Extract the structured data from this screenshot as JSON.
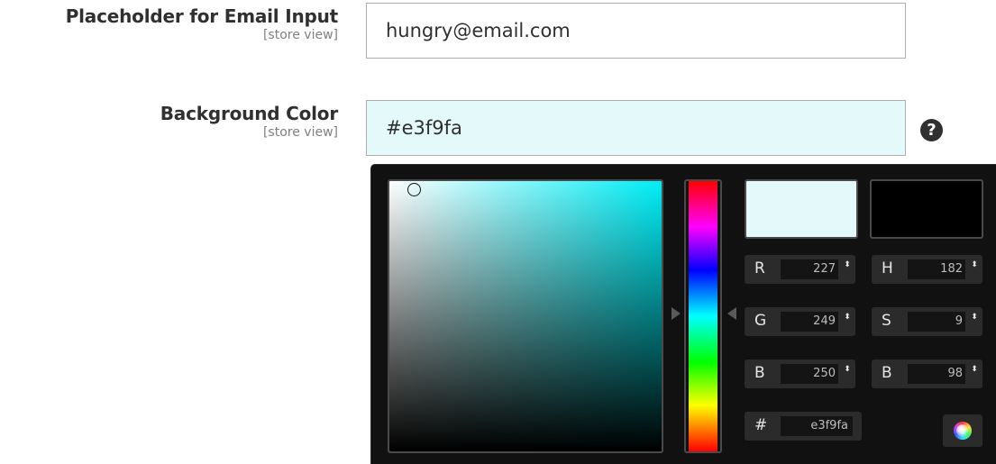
{
  "email_placeholder_field": {
    "label": "Placeholder for Email Input",
    "scope": "[store view]",
    "value": "hungry@email.com"
  },
  "background_color_field": {
    "label": "Background Color",
    "scope": "[store view]",
    "value": "#e3f9fa",
    "help_icon": "question-circle-icon",
    "help_glyph": "?"
  },
  "color_picker": {
    "new_color": "#e3f9fa",
    "current_color": "#000000",
    "hue_color": "#00eef6",
    "channels": {
      "r": {
        "letter": "R",
        "value": "227"
      },
      "g": {
        "letter": "G",
        "value": "249"
      },
      "b": {
        "letter": "B",
        "value": "250"
      },
      "h": {
        "letter": "H",
        "value": "182"
      },
      "s": {
        "letter": "S",
        "value": "9"
      },
      "br": {
        "letter": "B",
        "value": "98"
      }
    },
    "hex": {
      "letter": "#",
      "value": "e3f9fa"
    },
    "spinner_glyph": "⬍",
    "submit_icon": "color-wheel-icon"
  }
}
